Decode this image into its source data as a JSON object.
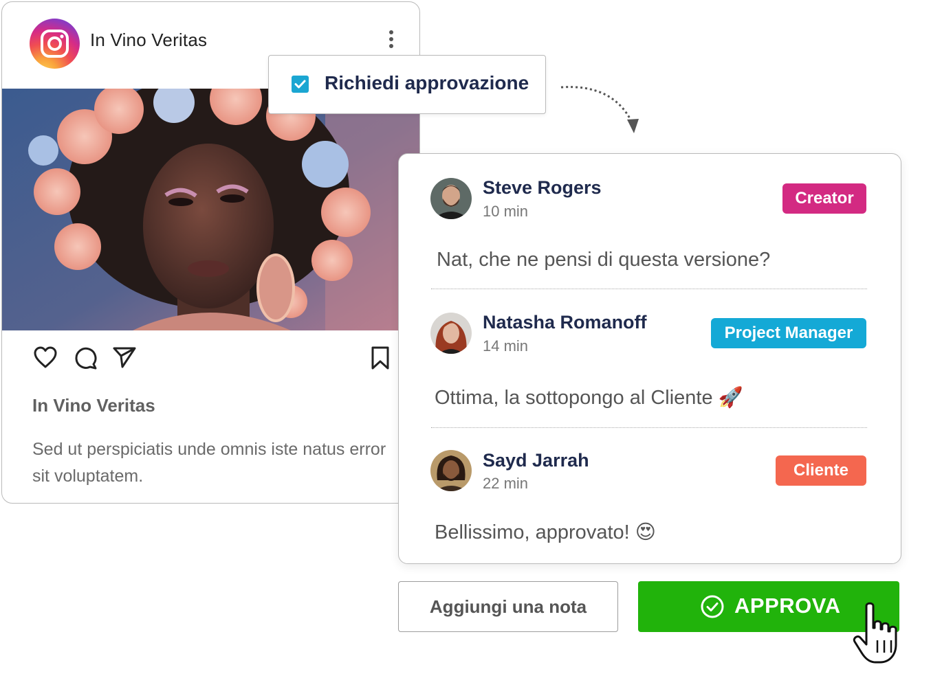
{
  "post": {
    "account_name": "In Vino Veritas",
    "platform_icon": "instagram-icon",
    "title": "In Vino Veritas",
    "caption": "Sed ut perspiciatis unde omnis iste natus error sit voluptatem."
  },
  "approval": {
    "checked": true,
    "label": "Richiedi approvazione"
  },
  "comments": [
    {
      "author": "Steve Rogers",
      "time": "10 min",
      "role": "Creator",
      "role_color": "#d32a82",
      "message": "Nat, che ne pensi di questa versione?"
    },
    {
      "author": "Natasha Romanoff",
      "time": "14 min",
      "role": "Project Manager",
      "role_color": "#14a9d6",
      "message": "Ottima, la sottopongo al Cliente 🚀"
    },
    {
      "author": "Sayd Jarrah",
      "time": "22 min",
      "role": "Cliente",
      "role_color": "#f4674f",
      "message": "Bellissimo, approvato! 😍"
    }
  ],
  "actions": {
    "note_label": "Aggiungi una nota",
    "approve_label": "APPROVA",
    "approve_color": "#21b30b"
  }
}
